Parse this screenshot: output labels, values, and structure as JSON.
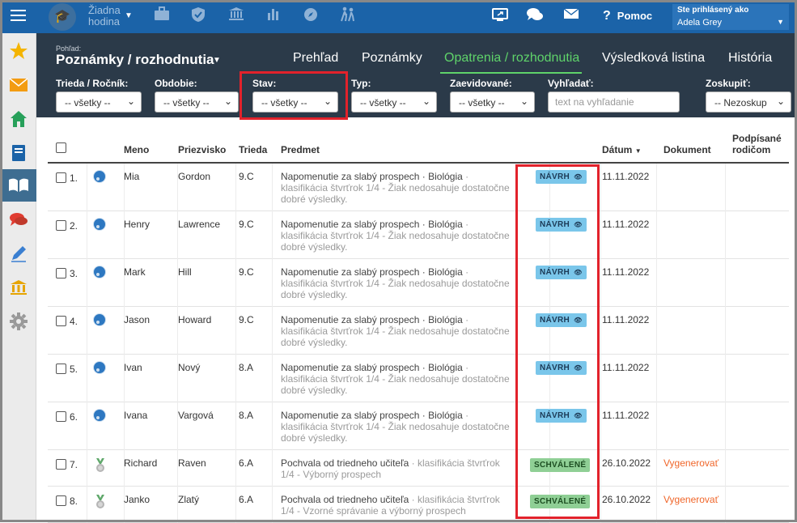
{
  "topbar": {
    "lesson_line1": "Žiadna",
    "lesson_line2": "hodina",
    "help_label": "Pomoc",
    "user_label": "Ste prihlásený ako",
    "user_name": "Adela Grey"
  },
  "header": {
    "view_label": "Pohľad:",
    "view_title": "Poznámky / rozhodnutia",
    "tabs": [
      {
        "label": "Prehľad"
      },
      {
        "label": "Poznámky"
      },
      {
        "label": "Opatrenia / rozhodnutia",
        "active": true
      },
      {
        "label": "Výsledková listina"
      },
      {
        "label": "História"
      }
    ]
  },
  "filters": {
    "class_label": "Trieda / Ročník:",
    "class_value": "-- všetky --",
    "period_label": "Obdobie:",
    "period_value": "-- všetky --",
    "state_label": "Stav:",
    "state_value": "-- všetky --",
    "type_label": "Typ:",
    "type_value": "-- všetky --",
    "recorded_label": "Zaevidované:",
    "recorded_value": "-- všetky --",
    "search_label": "Vyhľadať:",
    "search_placeholder": "text na vyhľadanie",
    "group_label": "Zoskupiť:",
    "group_value": "-- Nezoskup"
  },
  "table": {
    "headers": {
      "name": "Meno",
      "surname": "Priezvisko",
      "class": "Trieda",
      "subject": "Predmet",
      "date": "Dátum",
      "document": "Dokument",
      "signed_line1": "Podpísané",
      "signed_line2": "rodičom"
    },
    "rows": [
      {
        "num": "1.",
        "name": "Mia",
        "surname": "Gordon",
        "class": "9.C",
        "subject_main": "Napomenutie za slabý prospech · Biológia",
        "subject_sub1": " · ",
        "subject_sub2": "klasifikácia štvrťrok 1/4 - Žiak nedosahuje dostatočne",
        "subject_sub3": "dobré výsledky.",
        "status": "NÁVRH",
        "date": "11.11.2022",
        "document": ""
      },
      {
        "num": "2.",
        "name": "Henry",
        "surname": "Lawrence",
        "class": "9.C",
        "subject_main": "Napomenutie za slabý prospech · Biológia",
        "subject_sub1": " · ",
        "subject_sub2": "klasifikácia štvrťrok 1/4 - Žiak nedosahuje dostatočne",
        "subject_sub3": "dobré výsledky.",
        "status": "NÁVRH",
        "date": "11.11.2022",
        "document": ""
      },
      {
        "num": "3.",
        "name": "Mark",
        "surname": "Hill",
        "class": "9.C",
        "subject_main": "Napomenutie za slabý prospech · Biológia",
        "subject_sub1": " · ",
        "subject_sub2": "klasifikácia štvrťrok 1/4 - Žiak nedosahuje dostatočne",
        "subject_sub3": "dobré výsledky.",
        "status": "NÁVRH",
        "date": "11.11.2022",
        "document": ""
      },
      {
        "num": "4.",
        "name": "Jason",
        "surname": "Howard",
        "class": "9.C",
        "subject_main": "Napomenutie za slabý prospech · Biológia",
        "subject_sub1": " · ",
        "subject_sub2": "klasifikácia štvrťrok 1/4 - Žiak nedosahuje dostatočne",
        "subject_sub3": "dobré výsledky.",
        "status": "NÁVRH",
        "date": "11.11.2022",
        "document": ""
      },
      {
        "num": "5.",
        "name": "Ivan",
        "surname": "Nový",
        "class": "8.A",
        "subject_main": "Napomenutie za slabý prospech · Biológia",
        "subject_sub1": " · ",
        "subject_sub2": "klasifikácia štvrťrok 1/4 - Žiak nedosahuje dostatočne",
        "subject_sub3": "dobré výsledky.",
        "status": "NÁVRH",
        "date": "11.11.2022",
        "document": ""
      },
      {
        "num": "6.",
        "name": "Ivana",
        "surname": "Vargová",
        "class": "8.A",
        "subject_main": "Napomenutie za slabý prospech · Biológia",
        "subject_sub1": " · ",
        "subject_sub2": "klasifikácia štvrťrok 1/4 - Žiak nedosahuje dostatočne",
        "subject_sub3": "dobré výsledky.",
        "status": "NÁVRH",
        "date": "11.11.2022",
        "document": ""
      },
      {
        "num": "7.",
        "name": "Richard",
        "surname": "Raven",
        "class": "6.A",
        "subject_main": "Pochvala od triedneho učiteľa",
        "subject_sub1": " · klasifikácia štvrťrok",
        "subject_sub2": "1/4 - Výborný prospech",
        "subject_sub3": "",
        "status": "SCHVÁLENÉ",
        "date": "26.10.2022",
        "document": "Vygenerovať"
      },
      {
        "num": "8.",
        "name": "Janko",
        "surname": "Zlatý",
        "class": "6.A",
        "subject_main": "Pochvala od triedneho učiteľa",
        "subject_sub1": " · klasifikácia štvrťrok",
        "subject_sub2": "1/4 - Vzorné správanie a výborný prospech",
        "subject_sub3": "",
        "status": "SCHVÁLENÉ",
        "date": "26.10.2022",
        "document": "Vygenerovať"
      }
    ]
  },
  "colors": {
    "topbar": "#1b63a8",
    "header_bg": "#2b3a49",
    "active_tab": "#5fd36a",
    "highlight": "#e2222b",
    "badge_draft": "#7ac6ea",
    "badge_approved": "#8fcf95",
    "link": "#f0662a"
  },
  "icons": {
    "sidebar": [
      "star-icon",
      "envelope-icon",
      "home-icon",
      "book-icon",
      "open-book-icon",
      "chat-icon",
      "pen-icon",
      "institution-icon",
      "gear-icon"
    ],
    "top_nav": [
      "graduation-cap-icon",
      "briefcase-icon",
      "shield-icon",
      "institution-icon",
      "bar-chart-icon",
      "compass-icon",
      "students-icon"
    ],
    "top_right": [
      "screen-share-icon",
      "chat-bubbles-icon",
      "envelope-icon",
      "help-icon"
    ]
  }
}
